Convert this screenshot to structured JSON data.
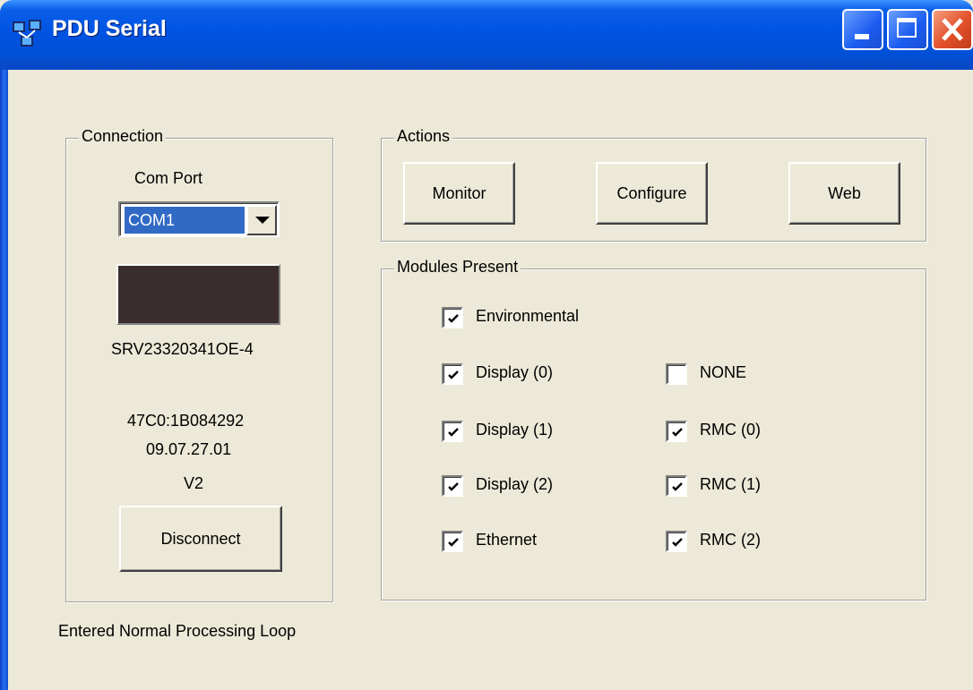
{
  "window": {
    "title": "PDU Serial"
  },
  "connection": {
    "group_title": "Connection",
    "com_port_label": "Com Port",
    "com_port_value": "COM1",
    "serial": "SRV23320341OE-4",
    "address": "47C0:1B084292",
    "date": "09.07.27.01",
    "version": "V2",
    "disconnect_label": "Disconnect"
  },
  "actions": {
    "group_title": "Actions",
    "monitor_label": "Monitor",
    "configure_label": "Configure",
    "web_label": "Web"
  },
  "modules": {
    "group_title": "Modules Present",
    "items": [
      {
        "label": "Environmental",
        "checked": true
      },
      {
        "label": "Display (0)",
        "checked": true
      },
      {
        "label": "NONE",
        "checked": false
      },
      {
        "label": "Display (1)",
        "checked": true
      },
      {
        "label": "RMC (0)",
        "checked": true
      },
      {
        "label": "Display (2)",
        "checked": true
      },
      {
        "label": "RMC (1)",
        "checked": true
      },
      {
        "label": "Ethernet",
        "checked": true
      },
      {
        "label": "RMC (2)",
        "checked": true
      }
    ]
  },
  "status": {
    "text": "Entered Normal Processing Loop"
  },
  "colors": {
    "title_bar": "#0054e3",
    "selection": "#316ac5",
    "close_button": "#e2502a",
    "face": "#ece9d8"
  }
}
